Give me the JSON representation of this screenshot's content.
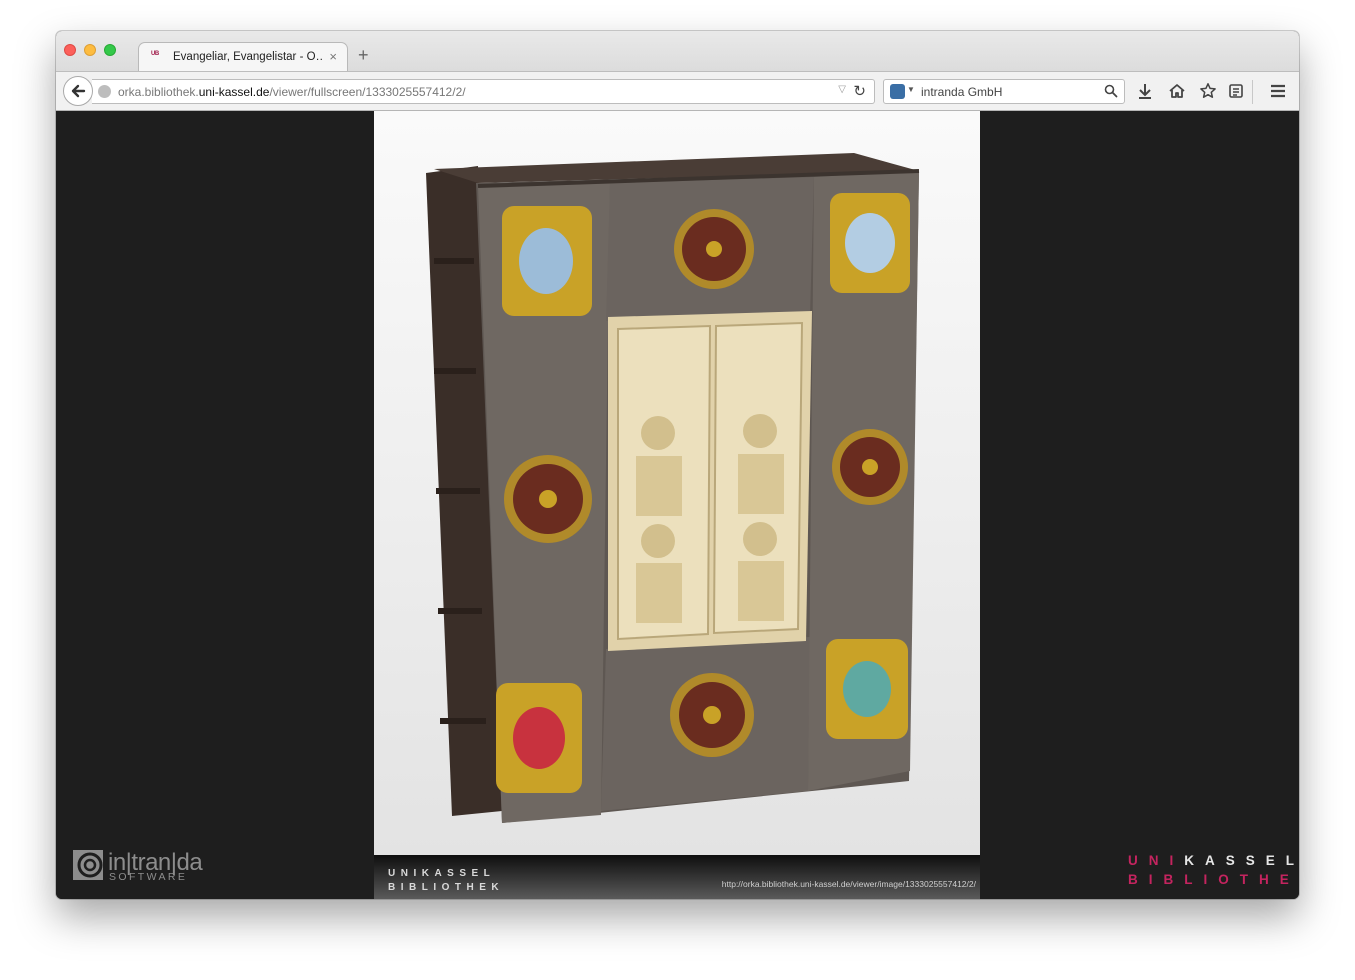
{
  "browser": {
    "tab": {
      "favicon_text": "UB",
      "title": "Evangeliar, Evangelistar - O…",
      "close_glyph": "×"
    },
    "new_tab_glyph": "+",
    "address_bar": {
      "url_prefix": "orka.bibliothek.",
      "url_domain": "uni-kassel.de",
      "url_path": "/viewer/fullscreen/1333025557412/2/"
    },
    "search_bar": {
      "engine": "intranda GmbH"
    },
    "toolbar_icons": [
      "back-arrow-icon",
      "globe-icon",
      "dropdown-icon",
      "reload-icon",
      "search-icon",
      "download-icon",
      "home-icon",
      "bookmark-star-icon",
      "reading-list-icon",
      "hamburger-menu-icon"
    ]
  },
  "viewer": {
    "image_alt": "Evangeliar, Evangelistar book cover with silver frame, gemstones and ivory diptych",
    "caption": {
      "logo_line1": "UNIKASSEL",
      "logo_line2": "BIBLIOTHEK",
      "image_url": "http://orka.bibliothek.uni-kassel.de/viewer/image/1333025557412/2/"
    },
    "footer_left": {
      "brand": "in|tran|da",
      "sub": "SOFTWARE"
    },
    "footer_right": {
      "line1_pink": "UNI",
      "line1_white": "KASSEL",
      "line2": "BIBLIOTHEK"
    }
  },
  "colors": {
    "brand_pink": "#c4245f",
    "viewer_bg": "#1e1e1e"
  }
}
